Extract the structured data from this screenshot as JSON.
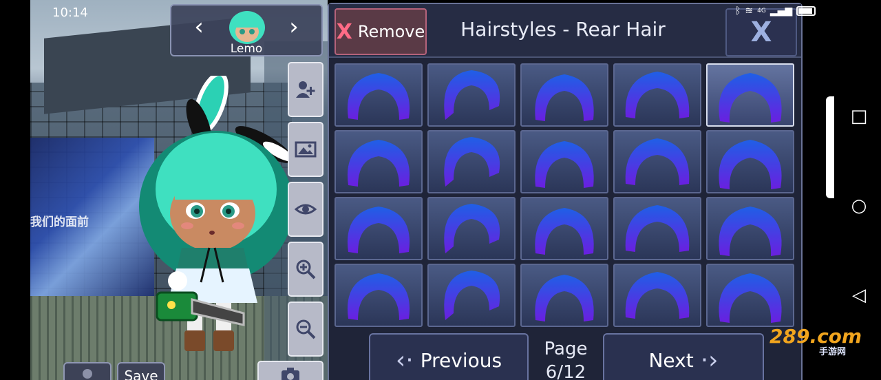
{
  "status_bar": {
    "time": "10:14",
    "network": "4G"
  },
  "character": {
    "name": "Lemo"
  },
  "scene": {
    "billboard_text": "我们的面前"
  },
  "side_tools": [
    "add-character-icon",
    "background-image-icon",
    "eye-icon",
    "zoom-in-icon",
    "zoom-out-icon"
  ],
  "bottom_left": {
    "save_label": "Save"
  },
  "panel": {
    "remove_x": "X",
    "remove_label": "Remove",
    "title": "Hairstyles - Rear Hair",
    "close_label": "X",
    "selected_index": 4,
    "items": [
      "rear-hair-1",
      "rear-hair-2",
      "rear-hair-3",
      "rear-hair-4",
      "rear-hair-5",
      "rear-hair-6",
      "rear-hair-7",
      "rear-hair-8",
      "rear-hair-9",
      "rear-hair-10",
      "rear-hair-11",
      "rear-hair-12",
      "rear-hair-13",
      "rear-hair-14",
      "rear-hair-15",
      "rear-hair-16",
      "rear-hair-17",
      "rear-hair-18",
      "rear-hair-19",
      "rear-hair-20"
    ],
    "prev_label": "Previous",
    "next_label": "Next",
    "page_label": "Page",
    "page_value": "6/12"
  },
  "watermark": {
    "main": "289.com",
    "sub": "手游网"
  },
  "colors": {
    "hair_top": "#1f5fe6",
    "hair_bottom": "#6a1fe0",
    "accent": "#b5637b"
  }
}
